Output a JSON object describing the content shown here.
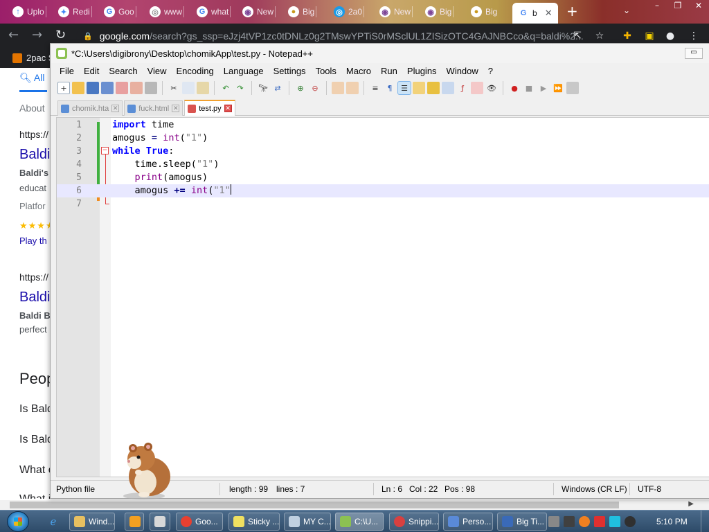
{
  "browser": {
    "tabs": [
      {
        "label": "Uplo"
      },
      {
        "label": "Redi"
      },
      {
        "label": "Goo"
      },
      {
        "label": "www"
      },
      {
        "label": "what"
      },
      {
        "label": "New"
      },
      {
        "label": "Big"
      },
      {
        "label": "2a0"
      },
      {
        "label": "New"
      },
      {
        "label": "Big"
      },
      {
        "label": "b"
      }
    ],
    "url_host": "google.com",
    "url_rest": "/search?gs_ssp=eJzj4tVP1zc0tDNLz0g2TMswYPTiS0rMSclUL1ZISizOTC4GAJNBCco&q=baldi%2...",
    "bookmark_label": "2pac S",
    "page": {
      "tab_all": "All",
      "about": "About",
      "results": [
        {
          "url": "https://",
          "title": "Baldi",
          "snippet_bold": "Baldi's",
          "snippet": "educat"
        },
        {
          "platform": "Platfor",
          "stars": "★★★★",
          "link": "Play th"
        },
        {
          "url": "https://",
          "title": "Baldi",
          "snippet_bold": "Baldi B",
          "snippet": "perfect"
        }
      ],
      "people_heading": "Peop",
      "questions": [
        "Is Bald",
        "Is Bald",
        "What c",
        "What i"
      ]
    }
  },
  "npp": {
    "title": "*C:\\Users\\digibrony\\Desktop\\chomikApp\\test.py - Notepad++",
    "menu": [
      "File",
      "Edit",
      "Search",
      "View",
      "Encoding",
      "Language",
      "Settings",
      "Tools",
      "Macro",
      "Run",
      "Plugins",
      "Window",
      "?"
    ],
    "tabs": [
      {
        "label": "chomik.hta",
        "active": false
      },
      {
        "label": "fuck.html",
        "active": false
      },
      {
        "label": "test.py",
        "active": true
      }
    ],
    "lines": [
      {
        "n": "1",
        "text": "import time"
      },
      {
        "n": "2",
        "text": "amogus = int(\"1\")"
      },
      {
        "n": "3",
        "text": "while True:"
      },
      {
        "n": "4",
        "text": "    time.sleep(\"1\")"
      },
      {
        "n": "5",
        "text": "    print(amogus)"
      },
      {
        "n": "6",
        "text": "    amogus += int(\"1\""
      },
      {
        "n": "7",
        "text": ""
      }
    ],
    "status": {
      "file_type": "Python file",
      "length": "length : 99",
      "lines": "lines : 7",
      "ln": "Ln : 6",
      "col": "Col : 22",
      "pos": "Pos : 98",
      "eol": "Windows (CR LF)",
      "encoding": "UTF-8"
    }
  },
  "taskbar": {
    "tasks": [
      {
        "label": "Wind..."
      },
      {
        "label": ""
      },
      {
        "label": ""
      },
      {
        "label": "Goo..."
      },
      {
        "label": "Sticky ..."
      },
      {
        "label": "MY C..."
      },
      {
        "label": "C:\\U..."
      },
      {
        "label": "Snippi..."
      },
      {
        "label": "Perso..."
      },
      {
        "label": "Big Ti..."
      }
    ],
    "clock": "5:10 PM"
  },
  "colors": {
    "keyword": "#0000ff",
    "builtin": "#880088",
    "string": "#808080",
    "current_line": "#e8e8ff",
    "link": "#1a0dab"
  }
}
